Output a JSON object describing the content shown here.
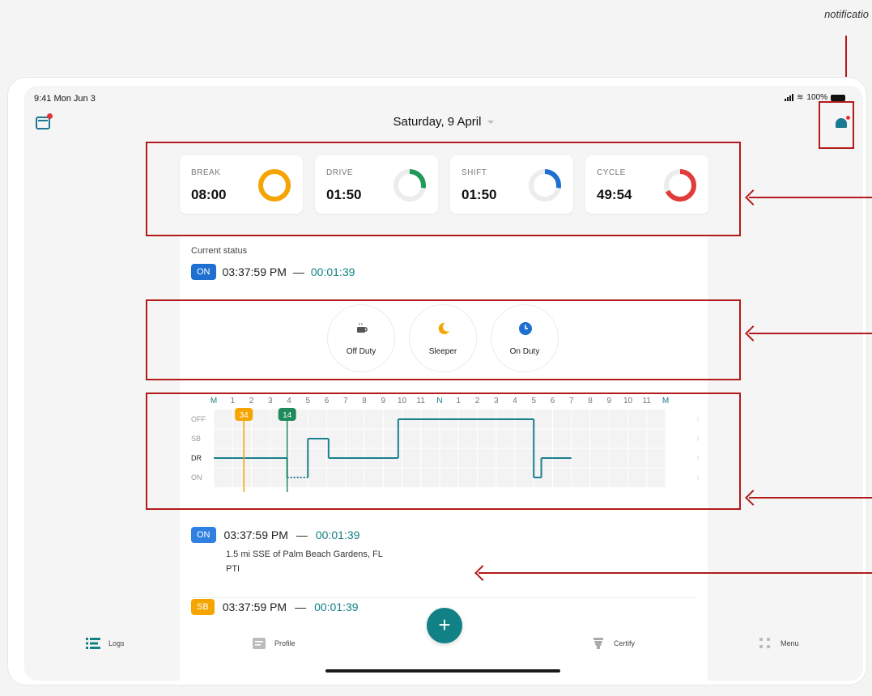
{
  "annotation": {
    "note": "notificatio"
  },
  "status_bar": {
    "time": "9:41 Mon Jun 3",
    "battery": "100%"
  },
  "header": {
    "date": "Saturday, 9 April"
  },
  "icons": {
    "calendar": "calendar-icon",
    "bell": "bell-icon",
    "coffee": "coffee-icon",
    "moon": "moon-icon",
    "clock": "clock-icon",
    "plus": "plus-icon"
  },
  "stats": [
    {
      "label": "BREAK",
      "value": "08:00",
      "color": "#f5a400",
      "fraction": 1.0
    },
    {
      "label": "DRIVE",
      "value": "01:50",
      "color": "#1f9a5a",
      "fraction": 0.28
    },
    {
      "label": "SHIFT",
      "value": "01:50",
      "color": "#1d6fd1",
      "fraction": 0.28
    },
    {
      "label": "CYCLE",
      "value": "49:54",
      "color": "#e23b3b",
      "fraction": 0.68
    }
  ],
  "current_status": {
    "label": "Current status",
    "badge": "ON",
    "badge_color": "#1e6fcf",
    "time": "03:37:59 PM",
    "dash": "—",
    "duration": "00:01:39"
  },
  "duty_buttons": [
    {
      "label": "Off Duty",
      "icon": "coffee-icon"
    },
    {
      "label": "Sleeper",
      "icon": "moon-icon"
    },
    {
      "label": "On Duty",
      "icon": "clock-icon"
    }
  ],
  "log_chart": {
    "hours": [
      "M",
      "1",
      "2",
      "3",
      "4",
      "5",
      "6",
      "7",
      "8",
      "9",
      "10",
      "11",
      "N",
      "1",
      "2",
      "3",
      "4",
      "5",
      "6",
      "7",
      "8",
      "9",
      "10",
      "11",
      "M"
    ],
    "rows": [
      "OFF",
      "SB",
      "DR",
      "ON"
    ],
    "markers": [
      {
        "label": "34",
        "hour": 1.6,
        "color": "#f5a400"
      },
      {
        "label": "14",
        "hour": 3.9,
        "color": "#1f8a5a"
      }
    ],
    "segments": [
      {
        "status": "DR",
        "from": 0,
        "to": 3.9
      },
      {
        "status": "ON",
        "from": 3.9,
        "to": 5.0,
        "dashed": true
      },
      {
        "status": "SB",
        "from": 5.0,
        "to": 6.1
      },
      {
        "status": "DR",
        "from": 6.1,
        "to": 9.8
      },
      {
        "status": "OFF",
        "from": 9.8,
        "to": 17.0
      },
      {
        "status": "ON",
        "from": 17.0,
        "to": 17.4
      },
      {
        "status": "DR",
        "from": 17.4,
        "to": 19.0
      }
    ],
    "line_color": "#1a7f8f"
  },
  "entries": [
    {
      "badge": "ON",
      "badge_color": "#1e6fcf",
      "time": "03:37:59 PM",
      "dash": "—",
      "duration": "00:01:39",
      "location": "1.5 mi SSE of Palm Beach Gardens, FL",
      "note": "PTI"
    },
    {
      "badge": "SB",
      "badge_color": "#f5a400",
      "time": "03:37:59 PM",
      "dash": "—",
      "duration": "00:01:39"
    }
  ],
  "tabs": {
    "logs": "Logs",
    "profile": "Profile",
    "certify": "Certify",
    "menu": "Menu"
  }
}
